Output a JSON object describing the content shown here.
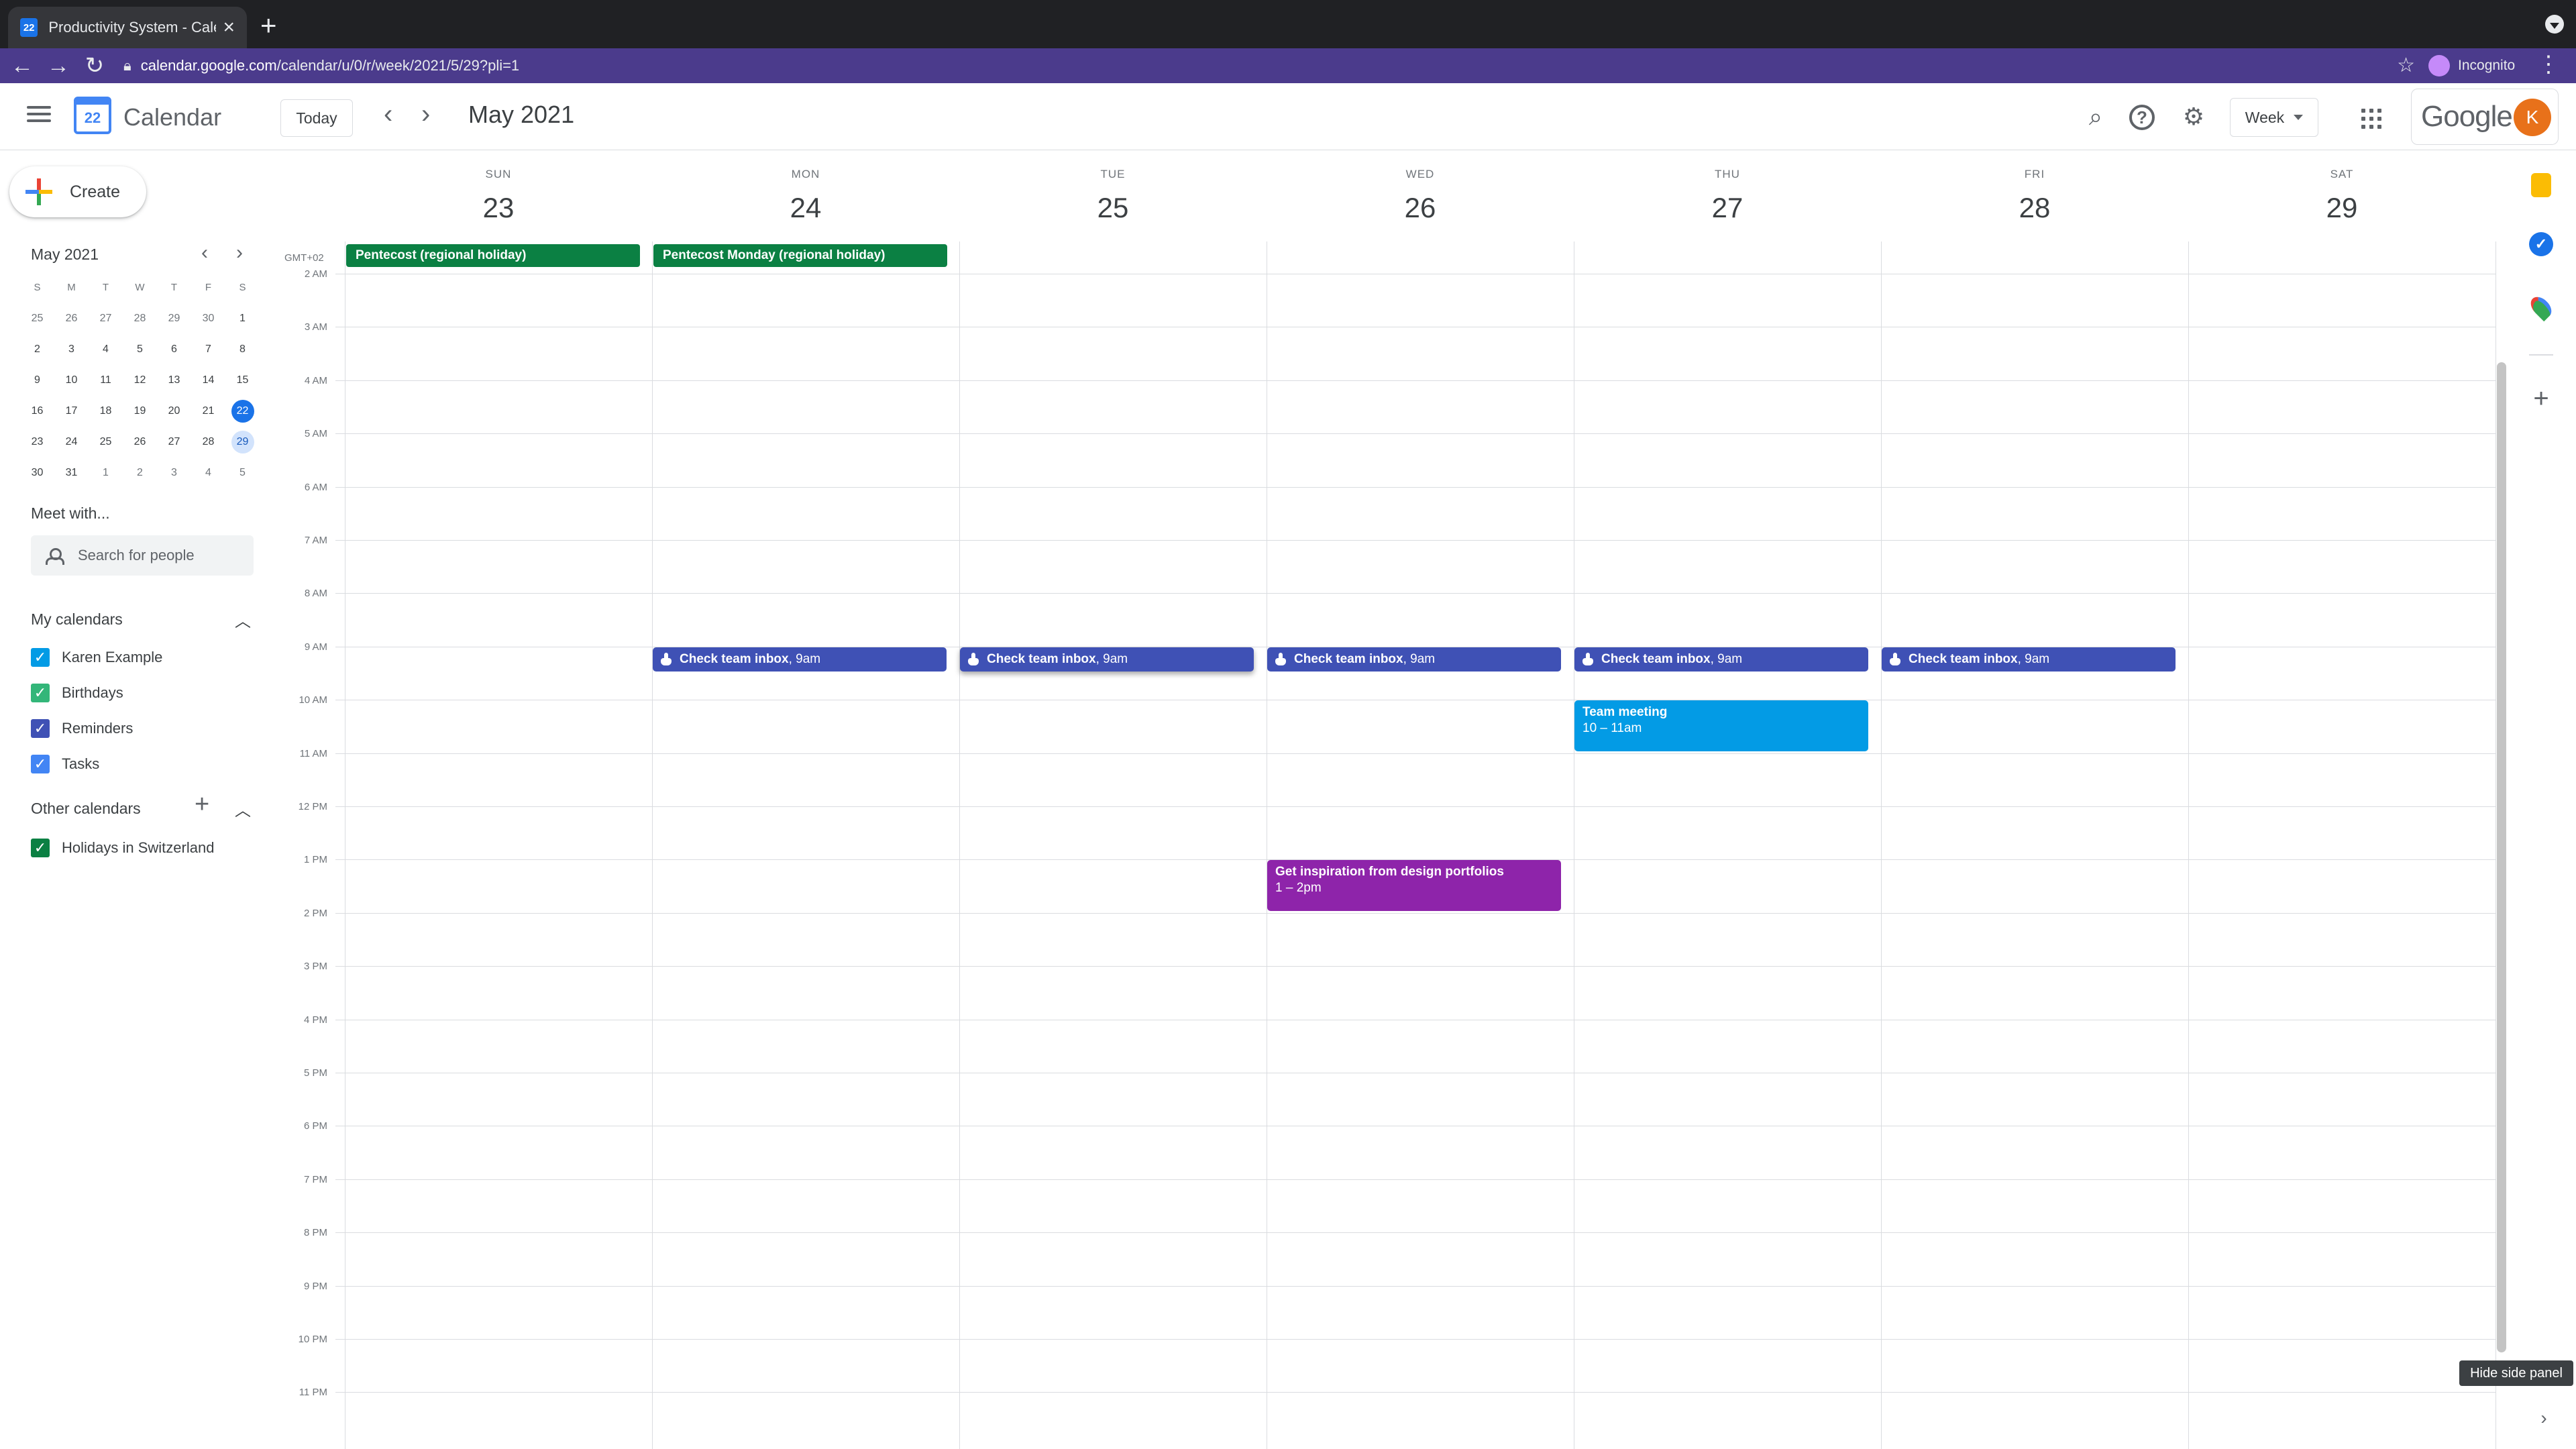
{
  "browser": {
    "tab_title": "Productivity System - Calendar",
    "tab_favicon_text": "22",
    "url_host": "calendar.google.com",
    "url_path": "/calendar/u/0/r/week/2021/5/29?pli=1",
    "incognito_label": "Incognito",
    "incognito_color": "#c58af9"
  },
  "header": {
    "logo_text": "22",
    "app_name": "Calendar",
    "today_label": "Today",
    "period": "May 2021",
    "view_label": "Week",
    "google_word": "Google",
    "avatar_initial": "K",
    "avatar_color": "#e8711a"
  },
  "sidebar": {
    "create_label": "Create",
    "mini_month": "May 2021",
    "mini_dow": [
      "S",
      "M",
      "T",
      "W",
      "T",
      "F",
      "S"
    ],
    "mini_weeks": [
      [
        "25",
        "26",
        "27",
        "28",
        "29",
        "30",
        "1"
      ],
      [
        "2",
        "3",
        "4",
        "5",
        "6",
        "7",
        "8"
      ],
      [
        "9",
        "10",
        "11",
        "12",
        "13",
        "14",
        "15"
      ],
      [
        "16",
        "17",
        "18",
        "19",
        "20",
        "21",
        "22"
      ],
      [
        "23",
        "24",
        "25",
        "26",
        "27",
        "28",
        "29"
      ],
      [
        "30",
        "31",
        "1",
        "2",
        "3",
        "4",
        "5"
      ]
    ],
    "mini_today": "22",
    "mini_selected": "29",
    "meet_with": "Meet with...",
    "search_people_placeholder": "Search for people",
    "my_calendars_label": "My calendars",
    "my_calendars": [
      {
        "label": "Karen Example",
        "color": "#039be5"
      },
      {
        "label": "Birthdays",
        "color": "#33b679"
      },
      {
        "label": "Reminders",
        "color": "#3f51b5"
      },
      {
        "label": "Tasks",
        "color": "#4285f4"
      }
    ],
    "other_calendars_label": "Other calendars",
    "other_calendars": [
      {
        "label": "Holidays in Switzerland",
        "color": "#0b8043"
      }
    ]
  },
  "week": {
    "timezone": "GMT+02",
    "days": [
      {
        "dow": "SUN",
        "num": "23"
      },
      {
        "dow": "MON",
        "num": "24"
      },
      {
        "dow": "TUE",
        "num": "25"
      },
      {
        "dow": "WED",
        "num": "26"
      },
      {
        "dow": "THU",
        "num": "27"
      },
      {
        "dow": "FRI",
        "num": "28"
      },
      {
        "dow": "SAT",
        "num": "29"
      }
    ],
    "hours": [
      "2 AM",
      "3 AM",
      "4 AM",
      "5 AM",
      "6 AM",
      "7 AM",
      "8 AM",
      "9 AM",
      "10 AM",
      "11 AM",
      "12 PM",
      "1 PM",
      "2 PM",
      "3 PM",
      "4 PM",
      "5 PM",
      "6 PM",
      "7 PM",
      "8 PM",
      "9 PM",
      "10 PM",
      "11 PM"
    ],
    "all_day": [
      {
        "day": 0,
        "title": "Pentecost (regional holiday)",
        "color": "#0b8043"
      },
      {
        "day": 1,
        "title": "Pentecost Monday (regional holiday)",
        "color": "#0b8043"
      }
    ],
    "inbox_events": [
      {
        "day": 1,
        "title": "Check team inbox",
        "time": ", 9am"
      },
      {
        "day": 2,
        "title": "Check team inbox",
        "time": ", 9am",
        "selected": true
      },
      {
        "day": 3,
        "title": "Check team inbox",
        "time": ", 9am"
      },
      {
        "day": 4,
        "title": "Check team inbox",
        "time": ", 9am"
      },
      {
        "day": 5,
        "title": "Check team inbox",
        "time": ", 9am"
      }
    ],
    "inbox_color": "#3f51b5",
    "block_events": [
      {
        "day": 4,
        "title": "Team meeting",
        "time": "10 – 11am",
        "color": "#039be5"
      },
      {
        "day": 3,
        "title": "Get inspiration from design portfolios",
        "time": "1 – 2pm",
        "color": "#8e24aa"
      }
    ]
  },
  "side_panel": {
    "tooltip": "Hide side panel"
  }
}
